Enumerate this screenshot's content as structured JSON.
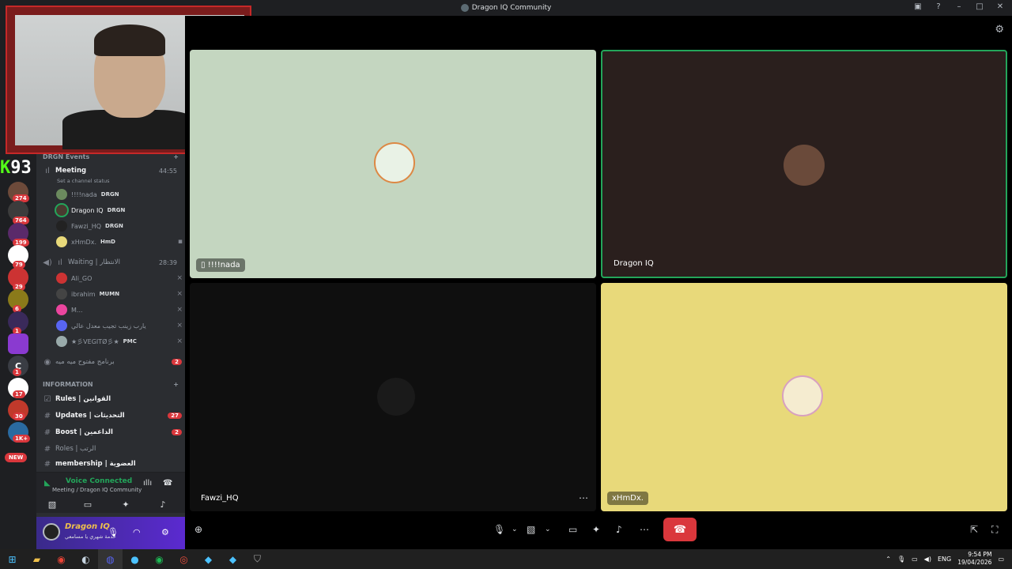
{
  "window": {
    "title": "Dragon IQ Community"
  },
  "servers": {
    "badges": [
      "274",
      "764",
      "199",
      "79",
      "29",
      "6",
      "1",
      "1",
      "17",
      "30",
      "1K+"
    ],
    "letter_c": "C",
    "new_label": "NEW"
  },
  "channels": {
    "category_events": "DRGN Events",
    "meeting": {
      "name": "Meeting",
      "time": "44:55",
      "status": "Set a channel status"
    },
    "meeting_members": [
      {
        "name": "!!!!nada",
        "tag": "DRGN"
      },
      {
        "name": "Dragon IQ",
        "tag": "DRGN"
      },
      {
        "name": "Fawzi_HQ",
        "tag": "DRGN"
      },
      {
        "name": "xHmDx.",
        "tag": "HmD"
      }
    ],
    "waiting": {
      "name": "Waiting | الانتظار",
      "time": "28:39"
    },
    "waiting_members": [
      {
        "name": "Ali_GO",
        "tag": ""
      },
      {
        "name": "ibrahim",
        "tag": "MUMN"
      },
      {
        "name": "M...",
        "tag": ""
      },
      {
        "name": "يارب زينب تجيب معدل عالي",
        "tag": ""
      },
      {
        "name": "★彡VEGITØ彡★",
        "tag": "PMC"
      }
    ],
    "program": {
      "name": "برنامج مفتوح ميه ميه",
      "count": "2"
    },
    "category_info": "INFORMATION",
    "info_channels": [
      {
        "name": "Rules | القوانين",
        "count": ""
      },
      {
        "name": "Updates | التحديثات",
        "count": "27"
      },
      {
        "name": "Boost | الداعمين",
        "count": "2"
      },
      {
        "name": "Roles | الرتب",
        "count": ""
      },
      {
        "name": "membership | العضوية",
        "count": ""
      }
    ]
  },
  "voice": {
    "connected": "Voice Connected",
    "location": "Meeting / Dragon IQ Community"
  },
  "user": {
    "name": "Dragon IQ",
    "status": "خدمة شهري يا مسامعي"
  },
  "webcam": {
    "score": "93",
    "k": "K"
  },
  "tiles": [
    {
      "name": "!!!!nada",
      "bg": "#c4d6c0"
    },
    {
      "name": "Dragon IQ",
      "bg": "#2a1f1d"
    },
    {
      "name": "Fawzi_HQ",
      "bg": "#0f0f0f"
    },
    {
      "name": "xHmDx.",
      "bg": "#e8d97a"
    }
  ],
  "tray": {
    "lang": "ENG",
    "time": "9:54 PM",
    "date": "19/04/2026"
  },
  "colors": {
    "accent": "#5865f2",
    "danger": "#da373c",
    "speaking": "#23a55a"
  }
}
